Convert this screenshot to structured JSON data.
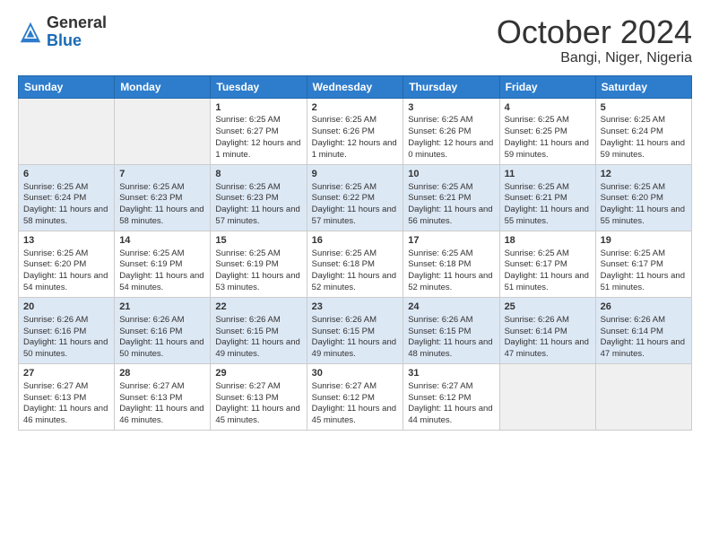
{
  "header": {
    "title": "October 2024",
    "location": "Bangi, Niger, Nigeria"
  },
  "columns": [
    "Sunday",
    "Monday",
    "Tuesday",
    "Wednesday",
    "Thursday",
    "Friday",
    "Saturday"
  ],
  "weeks": [
    [
      {
        "day": "",
        "info": ""
      },
      {
        "day": "",
        "info": ""
      },
      {
        "day": "1",
        "info": "Sunrise: 6:25 AM\nSunset: 6:27 PM\nDaylight: 12 hours and 1 minute."
      },
      {
        "day": "2",
        "info": "Sunrise: 6:25 AM\nSunset: 6:26 PM\nDaylight: 12 hours and 1 minute."
      },
      {
        "day": "3",
        "info": "Sunrise: 6:25 AM\nSunset: 6:26 PM\nDaylight: 12 hours and 0 minutes."
      },
      {
        "day": "4",
        "info": "Sunrise: 6:25 AM\nSunset: 6:25 PM\nDaylight: 11 hours and 59 minutes."
      },
      {
        "day": "5",
        "info": "Sunrise: 6:25 AM\nSunset: 6:24 PM\nDaylight: 11 hours and 59 minutes."
      }
    ],
    [
      {
        "day": "6",
        "info": "Sunrise: 6:25 AM\nSunset: 6:24 PM\nDaylight: 11 hours and 58 minutes."
      },
      {
        "day": "7",
        "info": "Sunrise: 6:25 AM\nSunset: 6:23 PM\nDaylight: 11 hours and 58 minutes."
      },
      {
        "day": "8",
        "info": "Sunrise: 6:25 AM\nSunset: 6:23 PM\nDaylight: 11 hours and 57 minutes."
      },
      {
        "day": "9",
        "info": "Sunrise: 6:25 AM\nSunset: 6:22 PM\nDaylight: 11 hours and 57 minutes."
      },
      {
        "day": "10",
        "info": "Sunrise: 6:25 AM\nSunset: 6:21 PM\nDaylight: 11 hours and 56 minutes."
      },
      {
        "day": "11",
        "info": "Sunrise: 6:25 AM\nSunset: 6:21 PM\nDaylight: 11 hours and 55 minutes."
      },
      {
        "day": "12",
        "info": "Sunrise: 6:25 AM\nSunset: 6:20 PM\nDaylight: 11 hours and 55 minutes."
      }
    ],
    [
      {
        "day": "13",
        "info": "Sunrise: 6:25 AM\nSunset: 6:20 PM\nDaylight: 11 hours and 54 minutes."
      },
      {
        "day": "14",
        "info": "Sunrise: 6:25 AM\nSunset: 6:19 PM\nDaylight: 11 hours and 54 minutes."
      },
      {
        "day": "15",
        "info": "Sunrise: 6:25 AM\nSunset: 6:19 PM\nDaylight: 11 hours and 53 minutes."
      },
      {
        "day": "16",
        "info": "Sunrise: 6:25 AM\nSunset: 6:18 PM\nDaylight: 11 hours and 52 minutes."
      },
      {
        "day": "17",
        "info": "Sunrise: 6:25 AM\nSunset: 6:18 PM\nDaylight: 11 hours and 52 minutes."
      },
      {
        "day": "18",
        "info": "Sunrise: 6:25 AM\nSunset: 6:17 PM\nDaylight: 11 hours and 51 minutes."
      },
      {
        "day": "19",
        "info": "Sunrise: 6:25 AM\nSunset: 6:17 PM\nDaylight: 11 hours and 51 minutes."
      }
    ],
    [
      {
        "day": "20",
        "info": "Sunrise: 6:26 AM\nSunset: 6:16 PM\nDaylight: 11 hours and 50 minutes."
      },
      {
        "day": "21",
        "info": "Sunrise: 6:26 AM\nSunset: 6:16 PM\nDaylight: 11 hours and 50 minutes."
      },
      {
        "day": "22",
        "info": "Sunrise: 6:26 AM\nSunset: 6:15 PM\nDaylight: 11 hours and 49 minutes."
      },
      {
        "day": "23",
        "info": "Sunrise: 6:26 AM\nSunset: 6:15 PM\nDaylight: 11 hours and 49 minutes."
      },
      {
        "day": "24",
        "info": "Sunrise: 6:26 AM\nSunset: 6:15 PM\nDaylight: 11 hours and 48 minutes."
      },
      {
        "day": "25",
        "info": "Sunrise: 6:26 AM\nSunset: 6:14 PM\nDaylight: 11 hours and 47 minutes."
      },
      {
        "day": "26",
        "info": "Sunrise: 6:26 AM\nSunset: 6:14 PM\nDaylight: 11 hours and 47 minutes."
      }
    ],
    [
      {
        "day": "27",
        "info": "Sunrise: 6:27 AM\nSunset: 6:13 PM\nDaylight: 11 hours and 46 minutes."
      },
      {
        "day": "28",
        "info": "Sunrise: 6:27 AM\nSunset: 6:13 PM\nDaylight: 11 hours and 46 minutes."
      },
      {
        "day": "29",
        "info": "Sunrise: 6:27 AM\nSunset: 6:13 PM\nDaylight: 11 hours and 45 minutes."
      },
      {
        "day": "30",
        "info": "Sunrise: 6:27 AM\nSunset: 6:12 PM\nDaylight: 11 hours and 45 minutes."
      },
      {
        "day": "31",
        "info": "Sunrise: 6:27 AM\nSunset: 6:12 PM\nDaylight: 11 hours and 44 minutes."
      },
      {
        "day": "",
        "info": ""
      },
      {
        "day": "",
        "info": ""
      }
    ]
  ]
}
